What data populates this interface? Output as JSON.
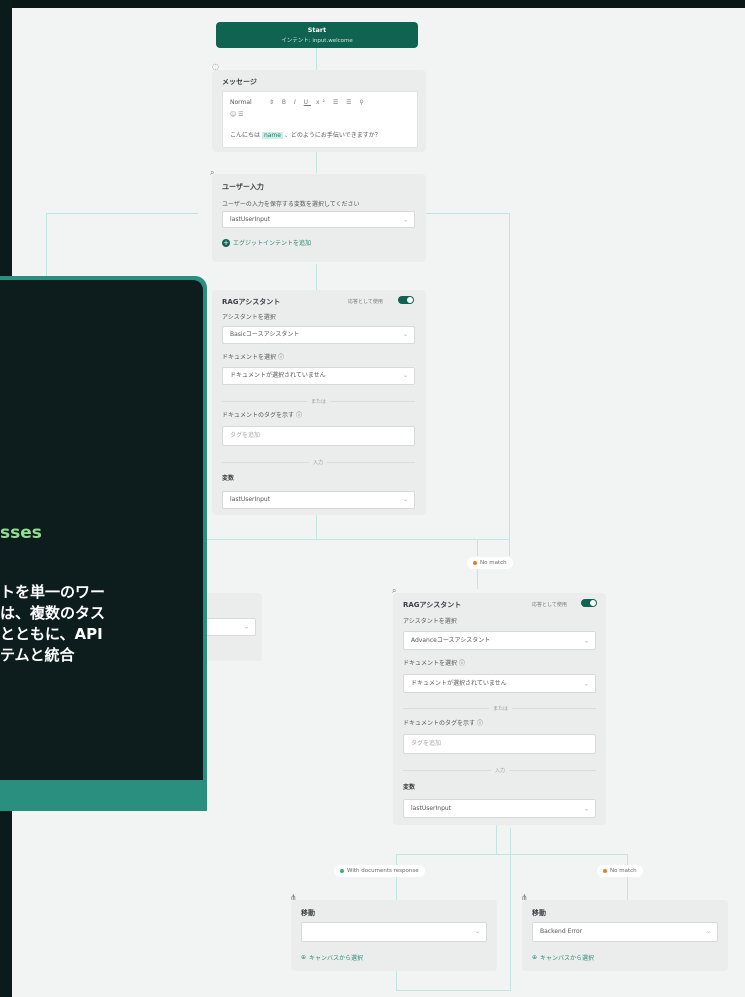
{
  "start": {
    "title": "Start",
    "subtitle": "インテント: input.welcome"
  },
  "message_node": {
    "title": "メッセージ",
    "toolbar": {
      "style": "Normal",
      "items": [
        "B",
        "I",
        "U",
        "x²",
        "☰",
        "☰",
        "🔗",
        "☺",
        "☰"
      ]
    },
    "text_before": "こんにちは",
    "variable": "name",
    "text_after": "、どのようにお手伝いできますか？"
  },
  "user_input_node": {
    "title": "ユーザー入力",
    "description": "ユーザーの入力を保存する変数を選択してください",
    "variable_value": "lastUserInput",
    "exit_intent_link": "エグジットインテントを追加"
  },
  "rag1": {
    "title": "RAGアシスタント",
    "toggle_label": "応答として使用",
    "assistant_label": "アシスタントを選択",
    "assistant_value": "Basicコースアシスタント",
    "document_label": "ドキュメントを選択",
    "document_value": "ドキュメントが選択されていません",
    "or_label": "または",
    "tag_label": "ドキュメントのタグを示す",
    "tag_placeholder": "タグを追加",
    "input_label": "入力",
    "variable_label": "変数",
    "variable_value": "lastUserInput"
  },
  "rag2": {
    "title": "RAGアシスタント",
    "toggle_label": "応答として使用",
    "assistant_label": "アシスタントを選択",
    "assistant_value": "Advanceコースアシスタント",
    "document_label": "ドキュメントを選択",
    "document_value": "ドキュメントが選択されていません",
    "or_label": "または",
    "tag_label": "ドキュメントのタグを示す",
    "tag_placeholder": "タグを追加",
    "input_label": "入力",
    "variable_label": "変数",
    "variable_value": "lastUserInput"
  },
  "badges": {
    "no_match_1": "No match",
    "with_docs": "With documents response",
    "no_match_2": "No match"
  },
  "move_left": {
    "title": "移動",
    "value": "",
    "link": "キャンバスから選択"
  },
  "move_right": {
    "title": "移動",
    "value": "Backend Error",
    "link": "キャンバスから選択"
  },
  "overlay": {
    "heading_fragment": "sses",
    "lines": [
      "トを単一のワー",
      "は、複数のタス",
      "とともに、API",
      "テムと統合"
    ]
  },
  "colors": {
    "accent": "#0f6350",
    "overlay_border": "#2a8f7f",
    "overlay_bg": "#0d1c1c",
    "heading": "#8fe08f",
    "green_dot": "#3cb371",
    "orange_dot": "#f07a2a"
  },
  "icons": {
    "info": "info-icon",
    "chevron": "chevron-down-icon",
    "plus": "plus-circle-icon",
    "crosshair": "crosshair-icon"
  }
}
